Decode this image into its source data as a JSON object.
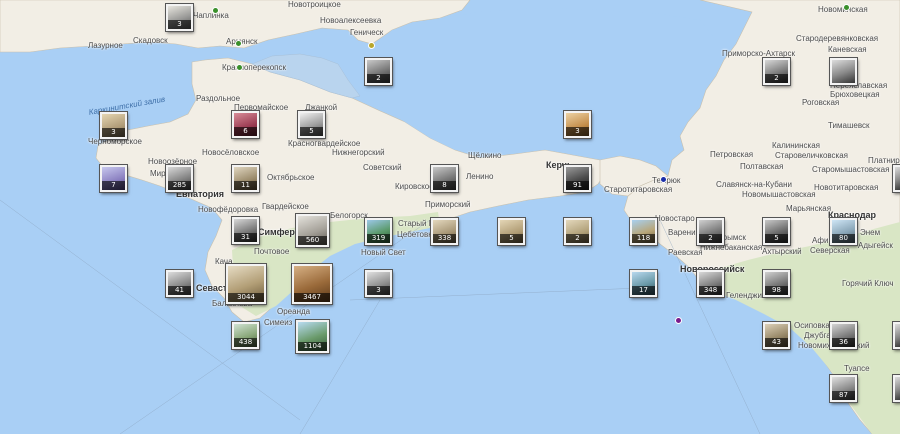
{
  "map": {
    "sea_labels": [
      {
        "id": "karkinitsky-bay",
        "text": "Каркинитский залив"
      }
    ],
    "place_labels": [
      {
        "id": "chaplinka",
        "text": "Чаплинка",
        "big": false
      },
      {
        "id": "novotroitskoe",
        "text": "Новотроицкое",
        "big": false
      },
      {
        "id": "skadovsk",
        "text": "Скадовск",
        "big": false
      },
      {
        "id": "lazurnoe",
        "text": "Лазурное",
        "big": false
      },
      {
        "id": "novoalekseevka",
        "text": "Новоалексеевка",
        "big": false
      },
      {
        "id": "genichesk",
        "text": "Геническ",
        "big": false
      },
      {
        "id": "armyansk",
        "text": "Армянск",
        "big": false
      },
      {
        "id": "krasnoperekopsk",
        "text": "Красноперекопск",
        "big": false
      },
      {
        "id": "razdolnoe",
        "text": "Раздольное",
        "big": false
      },
      {
        "id": "pervomayskoe",
        "text": "Первомайское",
        "big": false
      },
      {
        "id": "dzhankoy",
        "text": "Джанкой",
        "big": false
      },
      {
        "id": "chernomorskoe",
        "text": "Черноморское",
        "big": false
      },
      {
        "id": "novoselovskoe",
        "text": "Новосёловское",
        "big": false
      },
      {
        "id": "krasnogvardeyskoe",
        "text": "Красногвардейское",
        "big": false
      },
      {
        "id": "nizhnegorsky",
        "text": "Нижнегорский",
        "big": false
      },
      {
        "id": "novoozernoe",
        "text": "Новоозёрное",
        "big": false
      },
      {
        "id": "mirnyy",
        "text": "Мирный",
        "big": false
      },
      {
        "id": "oktyabrskoe",
        "text": "Октябрьское",
        "big": false
      },
      {
        "id": "evpatoriya",
        "text": "Евпатория",
        "big": true
      },
      {
        "id": "novofedorovka",
        "text": "Новофёдоровка",
        "big": false
      },
      {
        "id": "gvardeyskoe",
        "text": "Гвардейское",
        "big": false
      },
      {
        "id": "sovetskiy",
        "text": "Советский",
        "big": false
      },
      {
        "id": "kirovskoe",
        "text": "Кировское",
        "big": false
      },
      {
        "id": "lenino",
        "text": "Ленино",
        "big": false
      },
      {
        "id": "shchelkino",
        "text": "Щёлкино",
        "big": false
      },
      {
        "id": "primorskiy",
        "text": "Приморский",
        "big": false
      },
      {
        "id": "kerch",
        "text": "Керчь",
        "big": true
      },
      {
        "id": "simferopol",
        "text": "Симферополь",
        "big": true
      },
      {
        "id": "belogorsk",
        "text": "Белогорск",
        "big": false
      },
      {
        "id": "staryy-krym",
        "text": "Старый Крым",
        "big": false
      },
      {
        "id": "kacha",
        "text": "Кача",
        "big": false
      },
      {
        "id": "pochtovoe",
        "text": "Почтовое",
        "big": false
      },
      {
        "id": "sevastopol",
        "text": "Севастополь",
        "big": true
      },
      {
        "id": "balaklava",
        "text": "Балаклава",
        "big": false
      },
      {
        "id": "oreanda",
        "text": "Ореанда",
        "big": false
      },
      {
        "id": "simeiz",
        "text": "Симеиз",
        "big": false
      },
      {
        "id": "novyy-svet",
        "text": "Новый Свет",
        "big": false
      },
      {
        "id": "tsebetovka",
        "text": "Цебетовка",
        "big": false
      },
      {
        "id": "temryuk",
        "text": "Темрюк",
        "big": false
      },
      {
        "id": "starotitarovskaya",
        "text": "Старотитаровская",
        "big": false
      },
      {
        "id": "novostaro",
        "text": "Новостаро",
        "big": false
      },
      {
        "id": "primorsko-akhtarsk",
        "text": "Приморско-Ахтарск",
        "big": false
      },
      {
        "id": "novoderevyankovskaya",
        "text": "Стародеревянковская",
        "big": false
      },
      {
        "id": "novominskaya",
        "text": "Новоминская",
        "big": false
      },
      {
        "id": "kanevskaya",
        "text": "Каневская",
        "big": false
      },
      {
        "id": "pereyaslavskaya",
        "text": "Переяславская",
        "big": false
      },
      {
        "id": "bryukhovetskaya",
        "text": "Брюховецкая",
        "big": false
      },
      {
        "id": "rogovskaya",
        "text": "Роговская",
        "big": false
      },
      {
        "id": "timashevsk",
        "text": "Тимашевск",
        "big": false
      },
      {
        "id": "kalininskaya",
        "text": "Калининская",
        "big": false
      },
      {
        "id": "starovelichkovskaya",
        "text": "Старовеличковская",
        "big": false
      },
      {
        "id": "platnirovskaya",
        "text": "Платнировская",
        "big": false
      },
      {
        "id": "staromyshastovskaya",
        "text": "Старомышастовская",
        "big": false
      },
      {
        "id": "novotitarovskaya",
        "text": "Новотитаровская",
        "big": false
      },
      {
        "id": "petrovskaya",
        "text": "Петровская",
        "big": false
      },
      {
        "id": "poltavskaya",
        "text": "Полтавская",
        "big": false
      },
      {
        "id": "slavyansk",
        "text": "Славянск-на-Кубани",
        "big": false
      },
      {
        "id": "novomyshastovskaya",
        "text": "Новомышастовская",
        "big": false
      },
      {
        "id": "maryanskaya",
        "text": "Марьянская",
        "big": false
      },
      {
        "id": "krasnodar",
        "text": "Краснодар",
        "big": true
      },
      {
        "id": "afipskiy",
        "text": "Афипский",
        "big": false
      },
      {
        "id": "adygeysk",
        "text": "Адыгейск",
        "big": false
      },
      {
        "id": "enem",
        "text": "Энем",
        "big": false
      },
      {
        "id": "varenikovskaya",
        "text": "Варениковская",
        "big": false
      },
      {
        "id": "krymsk",
        "text": "Крымск",
        "big": false
      },
      {
        "id": "nizhnebakanskaya",
        "text": "Нижнебаканская",
        "big": false
      },
      {
        "id": "akhtyrskiy",
        "text": "Ахтырский",
        "big": false
      },
      {
        "id": "severskaya",
        "text": "Северская",
        "big": false
      },
      {
        "id": "raevskaya",
        "text": "Раевская",
        "big": false
      },
      {
        "id": "novorossiysk",
        "text": "Новороссийск",
        "big": true
      },
      {
        "id": "gelendzhik",
        "text": "Геленджик",
        "big": false
      },
      {
        "id": "goryachiy-klyuch",
        "text": "Горячий Ключ",
        "big": false
      },
      {
        "id": "osipovka",
        "text": "Осиповка",
        "big": false
      },
      {
        "id": "dzhubga",
        "text": "Джубга",
        "big": false
      },
      {
        "id": "novomikhaylovskiy",
        "text": "Новомихайловский",
        "big": false
      },
      {
        "id": "tuapse",
        "text": "Туапсе",
        "big": false
      }
    ],
    "photo_markers": [
      {
        "id": "skadovsk-area",
        "count": "3"
      },
      {
        "id": "genichesk-south",
        "count": "2"
      },
      {
        "id": "chernomorskoe",
        "count": "3"
      },
      {
        "id": "tarkhankut",
        "count": "7"
      },
      {
        "id": "pervomayskoe",
        "count": "6"
      },
      {
        "id": "dzhankoy",
        "count": "5"
      },
      {
        "id": "novoozernoe",
        "count": "285"
      },
      {
        "id": "oktyabrskoe-w",
        "count": "11"
      },
      {
        "id": "kirovskoe",
        "count": "8"
      },
      {
        "id": "kerch",
        "count": "91"
      },
      {
        "id": "kerch-north",
        "count": "3"
      },
      {
        "id": "simferopol-west",
        "count": "31"
      },
      {
        "id": "simferopol",
        "count": "560"
      },
      {
        "id": "belogorsk",
        "count": "319"
      },
      {
        "id": "sudak",
        "count": "338"
      },
      {
        "id": "feodosiya-sea",
        "count": "5"
      },
      {
        "id": "opuk-sea",
        "count": "2"
      },
      {
        "id": "anapa",
        "count": "118"
      },
      {
        "id": "varenikovskaya",
        "count": "2"
      },
      {
        "id": "akhtyrskiy",
        "count": "5"
      },
      {
        "id": "krasnodar",
        "count": "80"
      },
      {
        "id": "sevastopol-west",
        "count": "41"
      },
      {
        "id": "sevastopol",
        "count": "3044"
      },
      {
        "id": "yalta",
        "count": "3467"
      },
      {
        "id": "alushta-sea",
        "count": "3"
      },
      {
        "id": "novorossiysk",
        "count": "17"
      },
      {
        "id": "novorossiysk-east",
        "count": "348"
      },
      {
        "id": "severskaya",
        "count": "98"
      },
      {
        "id": "balaklava",
        "count": "438"
      },
      {
        "id": "foros",
        "count": "1104"
      },
      {
        "id": "dzhubga",
        "count": "43"
      },
      {
        "id": "novomikhaylovskiy",
        "count": "36"
      },
      {
        "id": "tuapse",
        "count": "87"
      },
      {
        "id": "primorsko-akhtarsk",
        "count": "2"
      },
      {
        "id": "kanevskaya",
        "count": ""
      },
      {
        "id": "platnirovskaya-edge",
        "count": ""
      },
      {
        "id": "gk-edge",
        "count": ""
      },
      {
        "id": "tuapse-edge",
        "count": ""
      }
    ],
    "location_dots": [
      {
        "id": "armyansk-dot",
        "color": "#3a8f2a"
      },
      {
        "id": "krasnoperekopsk-dot",
        "color": "#3a8f2a"
      },
      {
        "id": "genichesk-dot",
        "color": "#b8a62a"
      },
      {
        "id": "chaplinka-dot",
        "color": "#3a8f2a"
      },
      {
        "id": "novominskaya-dot",
        "color": "#3a8f2a"
      },
      {
        "id": "temryuk-dot",
        "color": "#1b2ea8"
      },
      {
        "id": "sea-dot",
        "color": "#7a1a8c"
      }
    ]
  }
}
